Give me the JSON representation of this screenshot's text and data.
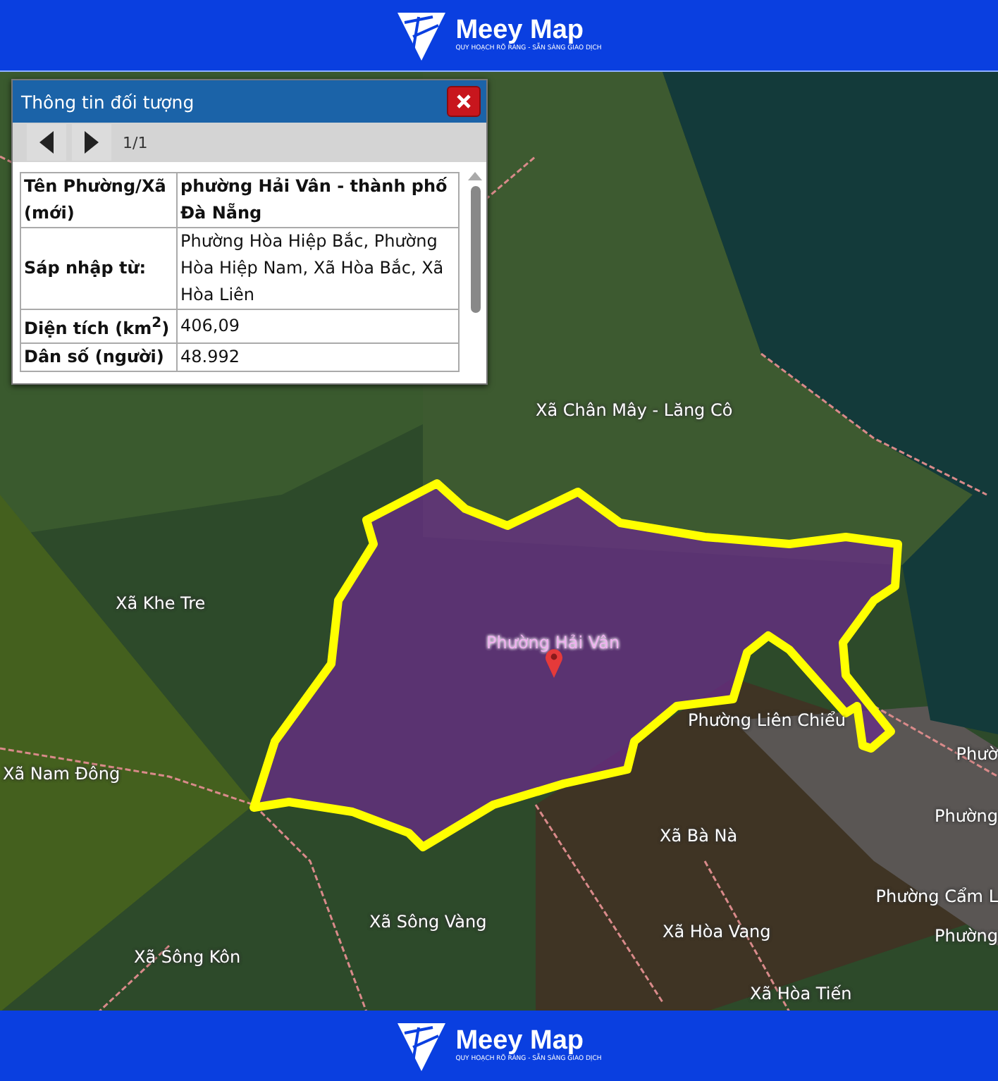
{
  "header": {
    "brand": "Meey Map",
    "tagline": "QUY HOẠCH RÕ RÀNG - SẴN SÀNG GIAO DỊCH"
  },
  "popup": {
    "title": "Thông tin đối tượng",
    "page": "1/1",
    "rows": [
      {
        "label": "Tên Phường/Xã (mới)",
        "value": "phường Hải Vân - thành phố Đà Nẵng",
        "bold_value": true
      },
      {
        "label": "Sáp nhập từ:",
        "value": "Phường Hòa Hiệp Bắc, Phường Hòa Hiệp Nam, Xã Hòa Bắc, Xã Hòa Liên",
        "bold_value": false
      },
      {
        "label": "Diện tích (km$^{2}$)",
        "value": "406,09",
        "bold_value": false
      },
      {
        "label": "Dân số (người)",
        "value": "48.992",
        "bold_value": false
      }
    ]
  },
  "map": {
    "labels": [
      {
        "text": "Xã Chân Mây - Lăng Cô",
        "kind": "area"
      },
      {
        "text": "Xã Khe Tre",
        "kind": "area"
      },
      {
        "text": "Phường Hải Vân",
        "kind": "selected"
      },
      {
        "text": "Phường Liên Chiểu",
        "kind": "area"
      },
      {
        "text": "Phườ",
        "kind": "area"
      },
      {
        "text": "Xã Nam Đông",
        "kind": "area"
      },
      {
        "text": "Phường",
        "kind": "area"
      },
      {
        "text": "Xã Bà Nà",
        "kind": "area"
      },
      {
        "text": "Phường Cẩm L",
        "kind": "area"
      },
      {
        "text": "Xã Sông Vàng",
        "kind": "area"
      },
      {
        "text": "Xã Hòa Vang",
        "kind": "area"
      },
      {
        "text": "Phường",
        "kind": "area"
      },
      {
        "text": "Xã Sông Kôn",
        "kind": "area"
      },
      {
        "text": "Xã Hòa Tiến",
        "kind": "area"
      }
    ]
  },
  "footer": {
    "brand": "Meey Map",
    "tagline": "QUY HOẠCH RÕ RÀNG - SẴN SÀNG GIAO DỊCH"
  }
}
